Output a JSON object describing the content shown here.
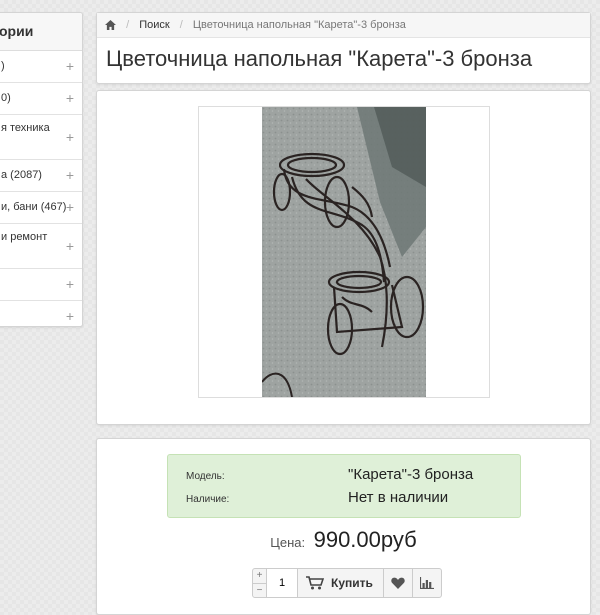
{
  "sidebar": {
    "title": "ории",
    "items": [
      {
        "label": ")"
      },
      {
        "label": "0)"
      },
      {
        "label": "я техника"
      },
      {
        "label": "а (2087)"
      },
      {
        "label": "и, бани (467)"
      },
      {
        "label": "и ремонт"
      },
      {
        "label": ""
      },
      {
        "label": ""
      }
    ],
    "expand_symbol": "+"
  },
  "breadcrumb": {
    "items": [
      "Поиск",
      "Цветочница напольная \"Карета\"-3 бронза"
    ],
    "separator": "/"
  },
  "product": {
    "title": "Цветочница напольная \"Карета\"-3 бронза",
    "attributes": [
      {
        "key": "Модель:",
        "value": "\"Карета\"-3 бронза"
      },
      {
        "key": "Наличие:",
        "value": "Нет в наличии"
      }
    ],
    "price_label": "Цена:",
    "price_value": "990.00руб"
  },
  "cart": {
    "quantity": "1",
    "plus": "+",
    "minus": "−",
    "buy_label": "Купить"
  },
  "icons": {
    "home": "home-icon",
    "cart": "cart-icon",
    "wishlist": "heart-icon",
    "compare": "bar-chart-icon"
  },
  "colors": {
    "attributes_background": "#dff0d8"
  }
}
